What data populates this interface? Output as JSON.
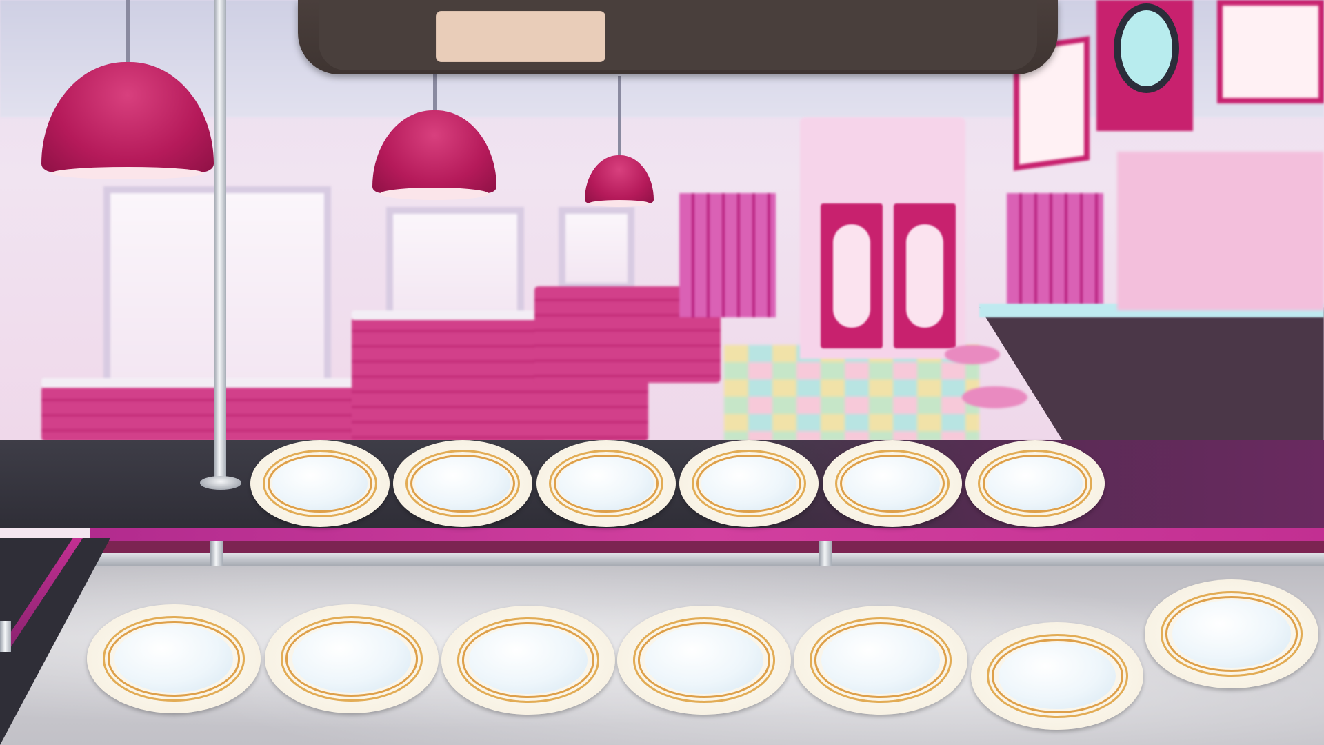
{
  "scene": {
    "name": "diner",
    "top_bar": {
      "label": ""
    },
    "colors": {
      "accent_pink": "#c8216e",
      "shelf_dark": "#2f2e37",
      "top_bar": "#4a3f3c",
      "label_slot": "#e9cdb9",
      "plate_rim": "#e2ac55"
    },
    "upper_shelf": {
      "plate_count": 6,
      "plates_state": "empty"
    },
    "lower_counter": {
      "plate_count": 7,
      "plates_state": "empty"
    }
  }
}
